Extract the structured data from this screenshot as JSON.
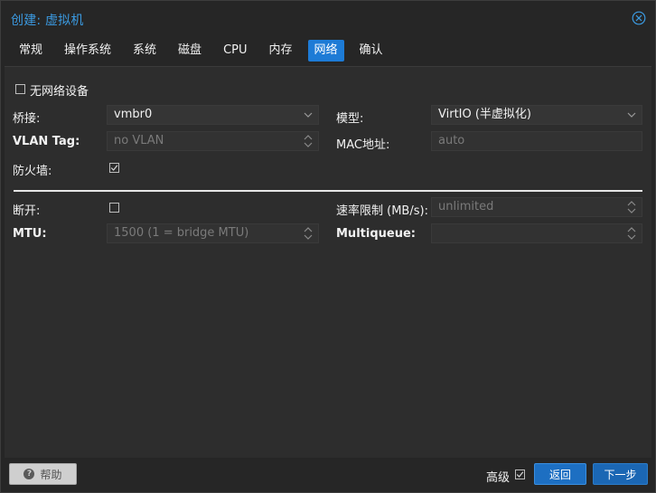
{
  "window": {
    "title": "创建: 虚拟机"
  },
  "tabs": [
    {
      "label": "常规",
      "active": false
    },
    {
      "label": "操作系统",
      "active": false
    },
    {
      "label": "系统",
      "active": false
    },
    {
      "label": "磁盘",
      "active": false
    },
    {
      "label": "CPU",
      "active": false
    },
    {
      "label": "内存",
      "active": false
    },
    {
      "label": "网络",
      "active": true
    },
    {
      "label": "确认",
      "active": false
    }
  ],
  "form": {
    "no_network": {
      "label": "无网络设备",
      "checked": false
    },
    "bridge": {
      "label": "桥接:",
      "value": "vmbr0"
    },
    "model": {
      "label": "模型:",
      "value": "VirtIO (半虚拟化)"
    },
    "vlan_tag": {
      "label": "VLAN Tag:",
      "placeholder": "no VLAN"
    },
    "mac_address": {
      "label": "MAC地址:",
      "placeholder": "auto"
    },
    "firewall": {
      "label": "防火墙:",
      "checked": true
    },
    "disconnect": {
      "label": "断开:",
      "checked": false
    },
    "rate_limit": {
      "label": "速率限制 (MB/s):",
      "placeholder": "unlimited"
    },
    "mtu": {
      "label": "MTU:",
      "placeholder": "1500 (1 = bridge MTU)"
    },
    "multiqueue": {
      "label": "Multiqueue:",
      "placeholder": ""
    }
  },
  "footer": {
    "help_label": "帮助",
    "advanced_label": "高级",
    "advanced_checked": true,
    "back_label": "返回",
    "next_label": "下一步"
  },
  "colors": {
    "accent": "#1d7bd6",
    "title": "#3b9ae1",
    "background": "#262626",
    "panel": "#2d2d2d"
  }
}
